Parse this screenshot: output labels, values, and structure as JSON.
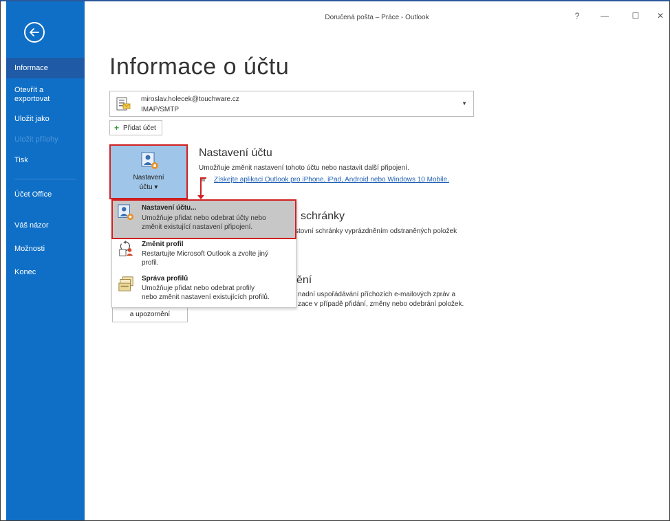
{
  "window": {
    "title": "Doručená pošta – Práce  -  Outlook",
    "help": "?",
    "minimize": "—",
    "maximize": "☐",
    "close": "✕"
  },
  "sidebar": {
    "items": [
      {
        "label": "Informace",
        "active": true
      },
      {
        "label": "Otevřít a exportovat"
      },
      {
        "label": "Uložit jako"
      },
      {
        "label": "Uložit přílohy",
        "disabled": true
      },
      {
        "label": "Tisk"
      },
      {
        "label": "Účet Office"
      },
      {
        "label": "Váš názor"
      },
      {
        "label": "Možnosti"
      },
      {
        "label": "Konec"
      }
    ]
  },
  "main": {
    "title": "Informace o účtu",
    "account": {
      "email": "miroslav.holecek@touchware.cz",
      "type": "IMAP/SMTP"
    },
    "add_account": "Přidat účet",
    "settings_button": {
      "line1": "Nastavení",
      "line2": "účtu ▾"
    },
    "section_settings": {
      "heading": "Nastavení účtu",
      "desc": "Umožňuje změnit nastavení tohoto účtu nebo nastavit další připojení.",
      "link": "Získejte aplikaci Outlook pro iPhone, iPad, Android nebo Windows 10 Mobile."
    },
    "section_mailbox": {
      "heading": "schránky",
      "desc": "stovní schránky vyprázdněním odstraněných položek"
    },
    "section_rules": {
      "heading": "ění",
      "desc1": "nadní uspořádávání příchozích e-mailových zpráv a",
      "desc2": "zace v případě přidání, změny nebo odebrání položek."
    },
    "rules_button_tail": "a upozornění"
  },
  "dropdown": {
    "items": [
      {
        "title": "Nastavení účtu...",
        "desc1": "Umožňuje přidat nebo odebrat účty nebo",
        "desc2": "změnit existující nastavení připojení."
      },
      {
        "title": "Změnit profil",
        "desc1": "Restartujte Microsoft Outlook a zvolte jiný",
        "desc2": "profil."
      },
      {
        "title": "Správa profilů",
        "desc1": "Umožňuje přidat nebo odebrat profily",
        "desc2": "nebo změnit nastavení existujících profilů."
      }
    ]
  }
}
